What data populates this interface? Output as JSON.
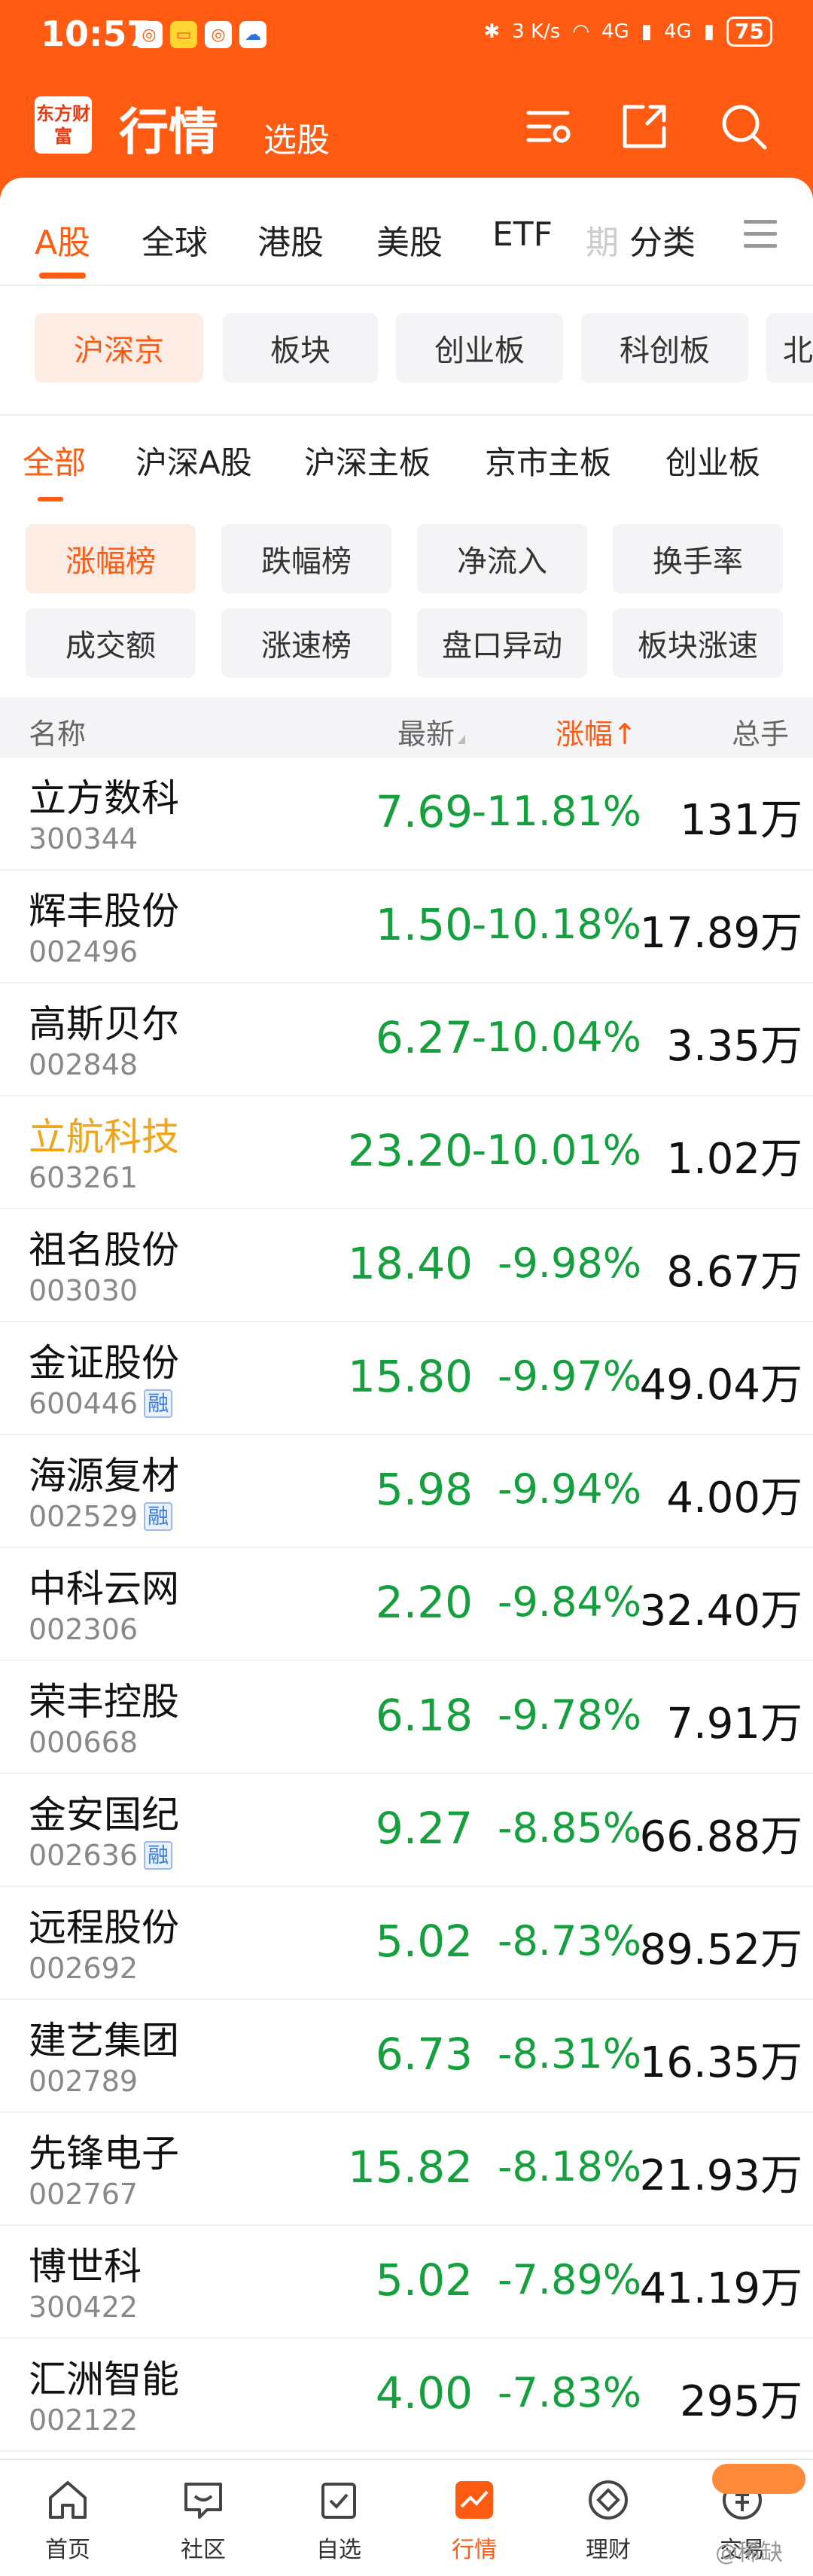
{
  "status_bar": {
    "time": "10:57",
    "net_speed": "3 K/s",
    "signal1": "4G",
    "signal2": "4G",
    "battery": "75"
  },
  "header": {
    "logo_text": "东方财富",
    "title": "行情",
    "subtitle": "选股"
  },
  "market_tabs": [
    "A股",
    "全球",
    "港股",
    "美股",
    "ETF",
    "期",
    "分类"
  ],
  "chips": [
    "沪深京",
    "板块",
    "创业板",
    "科创板",
    "北"
  ],
  "seg_tabs": [
    "全部",
    "沪深A股",
    "沪深主板",
    "京市主板",
    "创业板"
  ],
  "rank_buttons": [
    "涨幅榜",
    "跌幅榜",
    "净流入",
    "换手率",
    "成交额",
    "涨速榜",
    "盘口异动",
    "板块涨速"
  ],
  "table": {
    "columns": {
      "name": "名称",
      "latest": "最新",
      "change": "涨幅↑",
      "volume": "总手"
    },
    "rows": [
      {
        "name": "立方数科",
        "code": "300344",
        "price": "7.69",
        "change": "-11.81%",
        "volume": "131万",
        "margin": ""
      },
      {
        "name": "辉丰股份",
        "code": "002496",
        "price": "1.50",
        "change": "-10.18%",
        "volume": "17.89万",
        "margin": ""
      },
      {
        "name": "高斯贝尔",
        "code": "002848",
        "price": "6.27",
        "change": "-10.04%",
        "volume": "3.35万",
        "margin": ""
      },
      {
        "name": "立航科技",
        "code": "603261",
        "price": "23.20",
        "change": "-10.01%",
        "volume": "1.02万",
        "margin": ""
      },
      {
        "name": "祖名股份",
        "code": "003030",
        "price": "18.40",
        "change": "-9.98%",
        "volume": "8.67万",
        "margin": ""
      },
      {
        "name": "金证股份",
        "code": "600446",
        "price": "15.80",
        "change": "-9.97%",
        "volume": "49.04万",
        "margin": "融"
      },
      {
        "name": "海源复材",
        "code": "002529",
        "price": "5.98",
        "change": "-9.94%",
        "volume": "4.00万",
        "margin": "融"
      },
      {
        "name": "中科云网",
        "code": "002306",
        "price": "2.20",
        "change": "-9.84%",
        "volume": "32.40万",
        "margin": ""
      },
      {
        "name": "荣丰控股",
        "code": "000668",
        "price": "6.18",
        "change": "-9.78%",
        "volume": "7.91万",
        "margin": ""
      },
      {
        "name": "金安国纪",
        "code": "002636",
        "price": "9.27",
        "change": "-8.85%",
        "volume": "66.88万",
        "margin": "融"
      },
      {
        "name": "远程股份",
        "code": "002692",
        "price": "5.02",
        "change": "-8.73%",
        "volume": "89.52万",
        "margin": ""
      },
      {
        "name": "建艺集团",
        "code": "002789",
        "price": "6.73",
        "change": "-8.31%",
        "volume": "16.35万",
        "margin": ""
      },
      {
        "name": "先锋电子",
        "code": "002767",
        "price": "15.82",
        "change": "-8.18%",
        "volume": "21.93万",
        "margin": ""
      },
      {
        "name": "博世科",
        "code": "300422",
        "price": "5.02",
        "change": "-7.89%",
        "volume": "41.19万",
        "margin": ""
      },
      {
        "name": "汇洲智能",
        "code": "002122",
        "price": "4.00",
        "change": "-7.83%",
        "volume": "295万",
        "margin": ""
      }
    ]
  },
  "bottom_nav": [
    "首页",
    "社区",
    "自选",
    "行情",
    "理财",
    "交易"
  ],
  "watermark": "@稀缺",
  "colors": {
    "brand": "#ff5b12",
    "down": "#14a03c",
    "highlight": "#f2a417"
  }
}
